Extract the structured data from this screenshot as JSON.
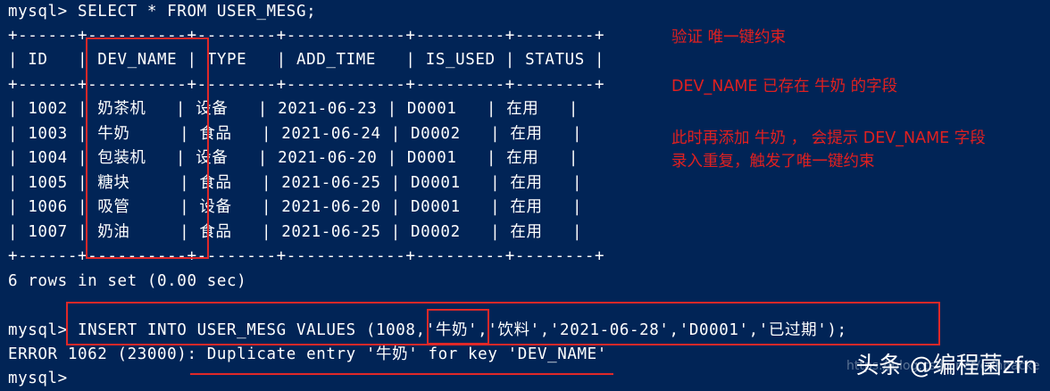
{
  "terminal": {
    "lines": [
      "mysql> SELECT * FROM USER_MESG;",
      "+------+----------+--------+------------+---------+--------+",
      "| ID   | DEV_NAME | TYPE   | ADD_TIME   | IS_USED | STATUS |",
      "+------+----------+--------+------------+---------+--------+",
      "| 1002 | 奶茶机   | 设备   | 2021-06-23 | D0001   | 在用   |",
      "| 1003 | 牛奶     | 食品   | 2021-06-24 | D0002   | 在用   |",
      "| 1004 | 包装机   | 设备   | 2021-06-20 | D0001   | 在用   |",
      "| 1005 | 糖块     | 食品   | 2021-06-25 | D0001   | 在用   |",
      "| 1006 | 吸管     | 设备   | 2021-06-20 | D0001   | 在用   |",
      "| 1007 | 奶油     | 食品   | 2021-06-25 | D0002   | 在用   |",
      "+------+----------+--------+------------+---------+--------+",
      "6 rows in set (0.00 sec)",
      "",
      "mysql> INSERT INTO USER_MESG VALUES (1008,'牛奶','饮料','2021-06-28','D0001','已过期');",
      "ERROR 1062 (23000): Duplicate entry '牛奶' for key 'DEV_NAME'",
      "mysql> "
    ]
  },
  "annotations": {
    "note1": "验证 唯一键约束",
    "note2": "DEV_NAME 已存在 牛奶 的字段",
    "note3_line1": "此时再添加 牛奶 ， 会提示 DEV_NAME 字段",
    "note3_line2": "录入重复，触发了唯一键约束"
  },
  "watermark": {
    "text": "头条 @编程菌zfn",
    "faint_url": "https://blog.csdn.net/cdhbacke"
  },
  "colors": {
    "background": "#012456",
    "text": "#ffffff",
    "annotation": "#e02020"
  }
}
